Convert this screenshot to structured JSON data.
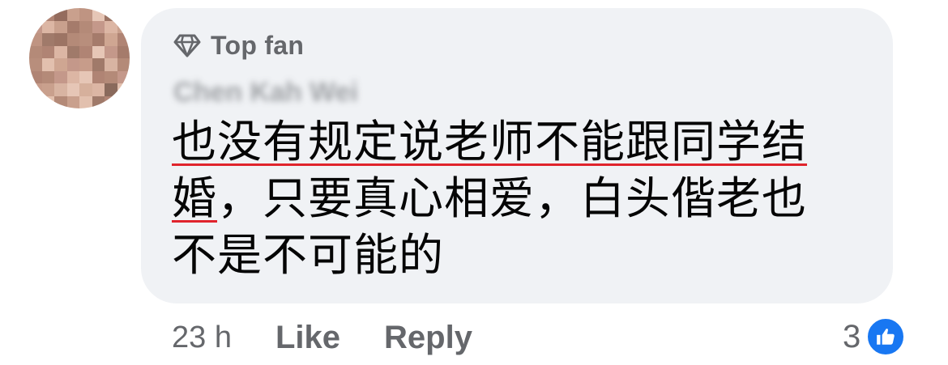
{
  "comment": {
    "badge_icon": "diamond-icon",
    "badge_label": "Top fan",
    "author_name": "Chen Kah Wei",
    "text_line_1": "也没有规定说老师不能跟同学结",
    "text_line_2_head": "婚",
    "text_line_2_tail": "，只要真心相爱，白头偕老也",
    "text_line_3": "不是不可能的"
  },
  "actions": {
    "time": "23 h",
    "like_label": "Like",
    "reply_label": "Reply"
  },
  "reactions": {
    "count": "3",
    "icon": "thumbs-up-icon",
    "color": "#1877f2"
  },
  "colors": {
    "bubble": "#f0f2f5",
    "meta_text": "#65676b",
    "body_text": "#050505",
    "spellcheck_underline": "#e0242c"
  }
}
